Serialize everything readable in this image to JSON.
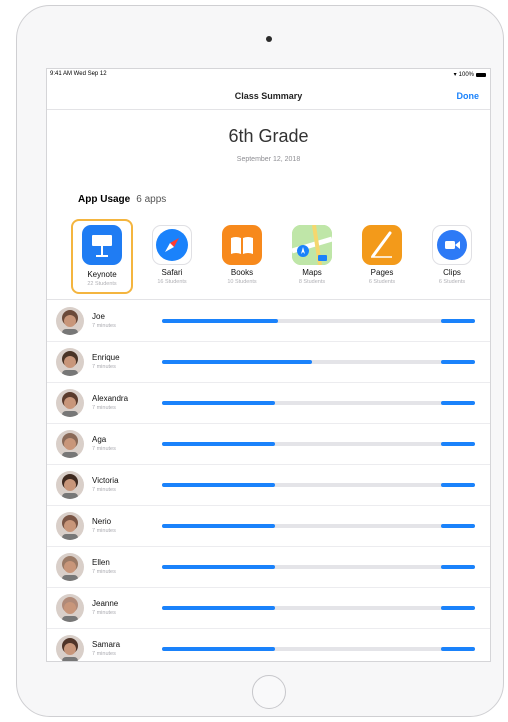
{
  "status_bar": {
    "time": "9:41 AM  Wed Sep 12",
    "battery": "100%"
  },
  "nav": {
    "title": "Class Summary",
    "done_label": "Done"
  },
  "header": {
    "grade": "6th Grade",
    "date": "September 12, 2018"
  },
  "section": {
    "title": "App Usage",
    "count": "6 apps"
  },
  "apps": [
    {
      "name": "Keynote",
      "count": "22 Students",
      "icon": "keynote-icon",
      "color": "#1f7cf3",
      "selected": true
    },
    {
      "name": "Safari",
      "count": "16 Students",
      "icon": "safari-icon",
      "color": "#1a82fb",
      "selected": false
    },
    {
      "name": "Books",
      "count": "10 Students",
      "icon": "books-icon",
      "color": "#f7891c",
      "selected": false
    },
    {
      "name": "Maps",
      "count": "8 Students",
      "icon": "maps-icon",
      "color": "#5cc36a",
      "selected": false
    },
    {
      "name": "Pages",
      "count": "6 Students",
      "icon": "pages-icon",
      "color": "#f39a1a",
      "selected": false
    },
    {
      "name": "Clips",
      "count": "6 Students",
      "icon": "clips-icon",
      "color": "#2d7af6",
      "selected": false
    }
  ],
  "students": [
    {
      "name": "Joe",
      "time": "7 minutes",
      "usage": 0.37
    },
    {
      "name": "Enrique",
      "time": "7 minutes",
      "usage": 0.48
    },
    {
      "name": "Alexandra",
      "time": "7 minutes",
      "usage": 0.36
    },
    {
      "name": "Aga",
      "time": "7 minutes",
      "usage": 0.36
    },
    {
      "name": "Victoria",
      "time": "7 minutes",
      "usage": 0.36
    },
    {
      "name": "Nerio",
      "time": "7 minutes",
      "usage": 0.36
    },
    {
      "name": "Ellen",
      "time": "7 minutes",
      "usage": 0.36
    },
    {
      "name": "Jeanne",
      "time": "7 minutes",
      "usage": 0.36
    },
    {
      "name": "Samara",
      "time": "7 minutes",
      "usage": 0.36
    }
  ],
  "colors": {
    "accent": "#1a82fb",
    "selection": "#f4b53f"
  }
}
